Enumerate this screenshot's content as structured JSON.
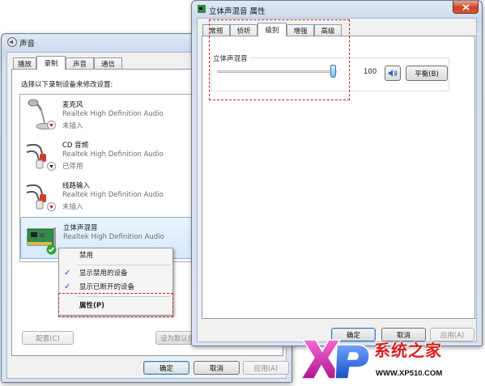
{
  "sound_dialog": {
    "title": "声音",
    "tabs": [
      "播放",
      "录制",
      "声音",
      "通信"
    ],
    "instruction": "选择以下录制设备来修改设置:",
    "devices": [
      {
        "name": "麦克风",
        "driver": "Realtek High Definition Audio",
        "status": "未插入",
        "icon": "microphone-icon",
        "badge": "red-down-arrow"
      },
      {
        "name": "CD 音频",
        "driver": "Realtek High Definition Audio",
        "status": "已停用",
        "icon": "rca-cable-icon",
        "badge": "gray-down-arrow"
      },
      {
        "name": "线路输入",
        "driver": "Realtek High Definition Audio",
        "status": "未插入",
        "icon": "rca-cable-icon",
        "badge": "red-down-arrow"
      },
      {
        "name": "立体声混音",
        "driver": "Realtek High Definition Audio",
        "status": "",
        "icon": "sound-card-icon",
        "badge": "green-check"
      }
    ],
    "configure_button": "配置(C)",
    "set_default_button": "设为默认值",
    "ok_button": "确定",
    "cancel_button": "取消",
    "apply_button": "应用(A)"
  },
  "context_menu": {
    "items": [
      {
        "label": "禁用",
        "checked": false
      },
      {
        "label": "显示禁用的设备",
        "checked": true
      },
      {
        "label": "显示已断开的设备",
        "checked": true
      },
      {
        "label": "属性(P)",
        "checked": false,
        "bold": true
      }
    ]
  },
  "props_dialog": {
    "title": "立体声混音 属性",
    "tabs": [
      "常规",
      "侦听",
      "级别",
      "增强",
      "高级"
    ],
    "selected_tab": "级别",
    "level_label": "立体声混音",
    "level_value": "100",
    "level_fraction": 1.0,
    "balance_button": "平衡(B)",
    "ok_button": "确定",
    "cancel_button": "取消",
    "apply_button": "应用(A)"
  },
  "watermark": {
    "logo_text": "XP系统之家",
    "url": "WWW.XP510.COM"
  },
  "colors": {
    "annotation_red": "#cc2222",
    "check_green": "#2eaa2e",
    "logo_magenta": "#d42ab0",
    "logo_blue": "#2b6ad8"
  }
}
